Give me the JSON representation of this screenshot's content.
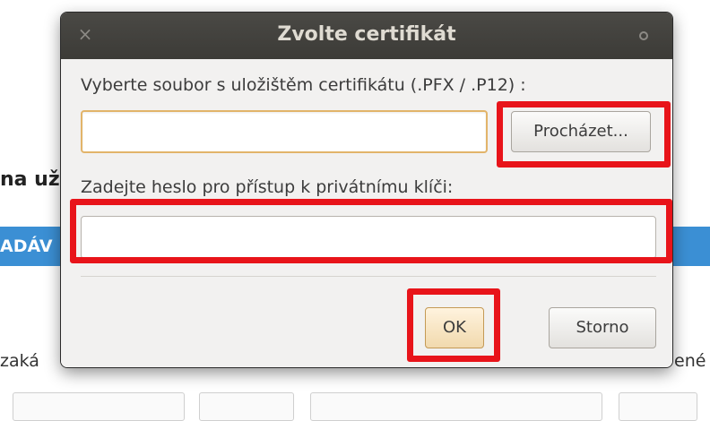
{
  "background": {
    "heading_fragment": "na už",
    "bar_fragment": "ADÁV",
    "left_label_fragment": "zaká",
    "right_label_fragment": "ené",
    "accent_color": "#3b8fd4"
  },
  "dialog": {
    "title": "Zvolte certifikát",
    "close_icon": "×",
    "file_label": "Vyberte soubor s uložištěm certifikátu (.PFX / .P12) :",
    "file_value": "",
    "browse_label": "Procházet...",
    "password_label": "Zadejte heslo pro přístup k privátnímu klíči:",
    "password_value": "",
    "ok_label": "OK",
    "cancel_label": "Storno"
  },
  "annotations": {
    "highlight_color": "#e8141a"
  }
}
